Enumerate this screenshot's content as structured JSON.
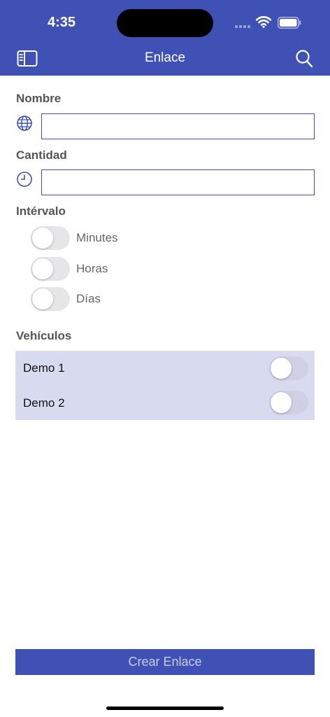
{
  "status_bar": {
    "time": "4:35"
  },
  "nav": {
    "title": "Enlace",
    "left_icon": "sidebar-icon",
    "right_icon": "search-icon"
  },
  "form": {
    "name_label": "Nombre",
    "name_value": "",
    "quantity_label": "Cantidad",
    "quantity_value": "",
    "interval_label": "Intérvalo",
    "interval_options": [
      {
        "label": "Minutes",
        "on": false
      },
      {
        "label": "Horas",
        "on": false
      },
      {
        "label": "Días",
        "on": false
      }
    ],
    "vehicles_label": "Vehículos",
    "vehicles": [
      {
        "label": "Demo 1",
        "on": false
      },
      {
        "label": "Demo 2",
        "on": false
      }
    ]
  },
  "actions": {
    "create_label": "Crear Enlace"
  },
  "colors": {
    "accent": "#3f51b5",
    "vehicle_panel": "#d8dbf0",
    "toggle_off": "#e6e6e9"
  },
  "icons": {
    "name_field": "globe-icon",
    "quantity_field": "clock-icon"
  }
}
